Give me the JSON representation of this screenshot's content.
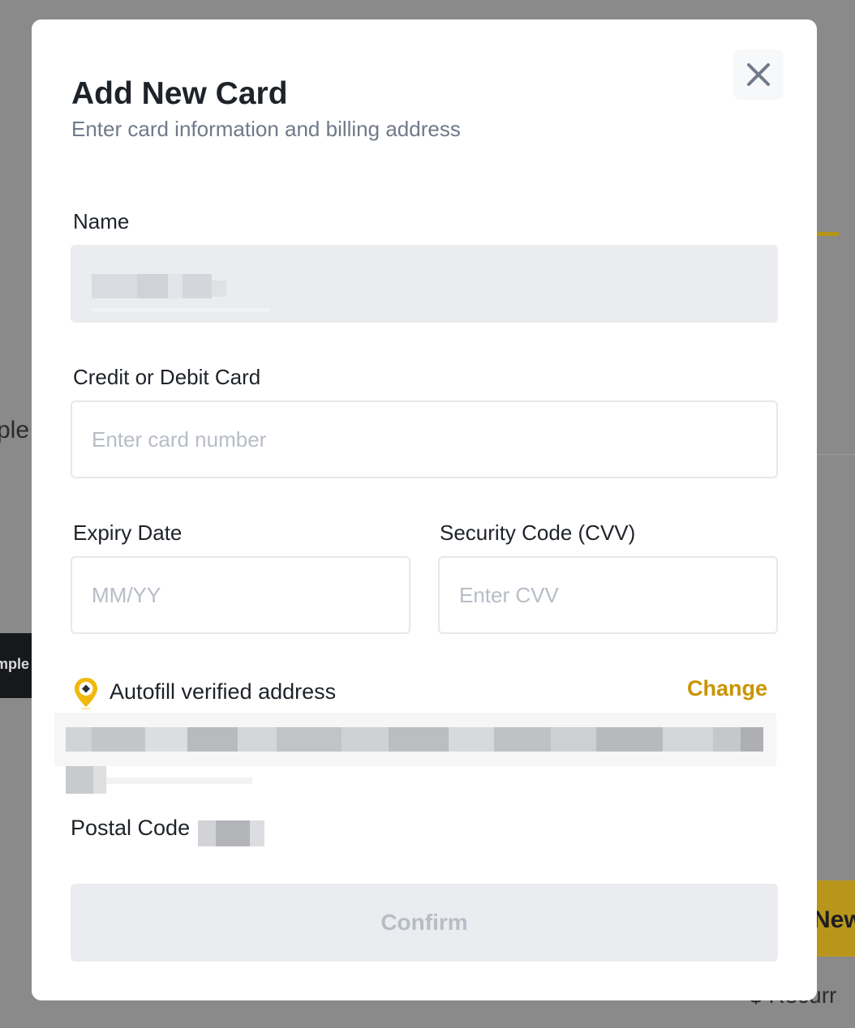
{
  "background": {
    "left_text_fragment": "ple",
    "logo_tile_text": "mple",
    "button_fragment": "New",
    "bottom_text_fragment": "$ Recurr"
  },
  "modal": {
    "title": "Add New Card",
    "subtitle": "Enter card information and billing address",
    "close_icon": "close-icon",
    "name": {
      "label": "Name",
      "value_redacted": true
    },
    "card": {
      "label": "Credit or Debit Card",
      "placeholder": "Enter card number",
      "value": ""
    },
    "expiry": {
      "label": "Expiry Date",
      "placeholder": "MM/YY",
      "value": ""
    },
    "cvv": {
      "label": "Security Code (CVV)",
      "placeholder": "Enter CVV",
      "value": ""
    },
    "address": {
      "icon": "location-pin-icon",
      "autofill_label": "Autofill verified address",
      "change_label": "Change",
      "value_redacted": true
    },
    "postal": {
      "label": "Postal Code",
      "value_redacted": true
    },
    "confirm_label": "Confirm"
  },
  "colors": {
    "accent": "#C99400",
    "pin_yellow": "#F0B90B",
    "text_primary": "#1E2329",
    "text_secondary": "#707A8A",
    "placeholder": "#B7BDC6",
    "disabled_bg": "#EAECEF"
  }
}
